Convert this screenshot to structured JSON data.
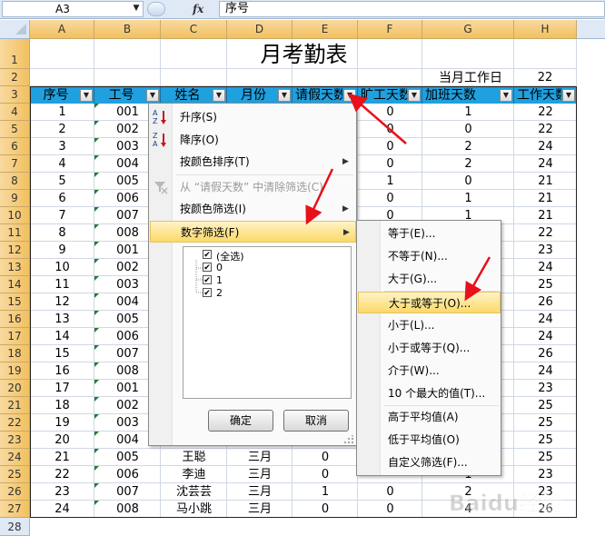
{
  "formula_bar": {
    "name_box": "A3",
    "fx": "fx",
    "formula": "序号"
  },
  "columns": [
    "A",
    "B",
    "C",
    "D",
    "E",
    "F",
    "G",
    "H"
  ],
  "rows": [
    "1",
    "2",
    "3",
    "4",
    "5",
    "6",
    "7",
    "8",
    "9",
    "10",
    "11",
    "12",
    "13",
    "14",
    "15",
    "16",
    "17",
    "18",
    "19",
    "20",
    "21",
    "22",
    "23",
    "24",
    "25",
    "26",
    "27",
    "28"
  ],
  "sheet": {
    "title": "月考勤表",
    "workday_label": "当月工作日",
    "workday_value": "22",
    "headers": [
      "序号",
      "工号",
      "姓名",
      "月份",
      "请假天数",
      "旷工天数",
      "加班天数",
      "工作天数"
    ],
    "rows": [
      [
        "1",
        "001",
        "",
        "",
        "",
        "0",
        "1",
        "22"
      ],
      [
        "2",
        "002",
        "",
        "",
        "",
        "0",
        "0",
        "22"
      ],
      [
        "3",
        "003",
        "",
        "",
        "",
        "0",
        "2",
        "24"
      ],
      [
        "4",
        "004",
        "",
        "",
        "",
        "0",
        "2",
        "24"
      ],
      [
        "5",
        "005",
        "",
        "",
        "",
        "1",
        "0",
        "21"
      ],
      [
        "6",
        "006",
        "",
        "",
        "",
        "0",
        "1",
        "21"
      ],
      [
        "7",
        "007",
        "",
        "",
        "",
        "0",
        "1",
        "21"
      ],
      [
        "8",
        "008",
        "",
        "",
        "",
        "",
        "",
        "22"
      ],
      [
        "9",
        "001",
        "",
        "",
        "",
        "",
        "",
        "23"
      ],
      [
        "10",
        "002",
        "",
        "",
        "",
        "",
        "",
        "24"
      ],
      [
        "11",
        "003",
        "",
        "",
        "",
        "",
        "",
        "25"
      ],
      [
        "12",
        "004",
        "",
        "",
        "",
        "",
        "",
        "26"
      ],
      [
        "13",
        "005",
        "",
        "",
        "",
        "",
        "",
        "24"
      ],
      [
        "14",
        "006",
        "",
        "",
        "",
        "",
        "",
        "24"
      ],
      [
        "15",
        "007",
        "",
        "",
        "",
        "",
        "",
        "26"
      ],
      [
        "16",
        "008",
        "",
        "",
        "",
        "",
        "",
        "24"
      ],
      [
        "17",
        "001",
        "",
        "",
        "",
        "",
        "",
        "23"
      ],
      [
        "18",
        "002",
        "",
        "",
        "",
        "",
        "",
        "25"
      ],
      [
        "19",
        "003",
        "",
        "",
        "",
        "",
        "",
        "25"
      ],
      [
        "20",
        "004",
        "",
        "",
        "",
        "",
        "",
        "25"
      ],
      [
        "21",
        "005",
        "王聪",
        "三月",
        "0",
        "",
        "",
        "25"
      ],
      [
        "22",
        "006",
        "李迪",
        "三月",
        "0",
        "",
        "1",
        "23"
      ],
      [
        "23",
        "007",
        "沈芸芸",
        "三月",
        "1",
        "0",
        "2",
        "23"
      ],
      [
        "24",
        "008",
        "马小跳",
        "三月",
        "0",
        "0",
        "4",
        "26"
      ]
    ]
  },
  "menu": {
    "sort_asc": "升序(S)",
    "sort_desc": "降序(O)",
    "sort_by_color": "按颜色排序(T)",
    "clear_filter": "从 “请假天数” 中清除筛选(C)",
    "filter_by_color": "按颜色筛选(I)",
    "number_filter": "数字筛选(F)",
    "list": [
      {
        "label": "(全选)",
        "checked": true
      },
      {
        "label": "0",
        "checked": true
      },
      {
        "label": "1",
        "checked": true
      },
      {
        "label": "2",
        "checked": true
      }
    ],
    "ok": "确定",
    "cancel": "取消"
  },
  "submenu": {
    "items": [
      "等于(E)...",
      "不等于(N)...",
      "大于(G)...",
      "大于或等于(O)...",
      "小于(L)...",
      "小于或等于(Q)...",
      "介于(W)...",
      "10 个最大的值(T)...",
      "高于平均值(A)",
      "低于平均值(O)",
      "自定义筛选(F)..."
    ]
  },
  "watermark": "Baidu经验",
  "colors": {
    "header_fill": "#1fa0df",
    "menu_highlight": "#fbd968",
    "arrow": "#e8101a"
  }
}
